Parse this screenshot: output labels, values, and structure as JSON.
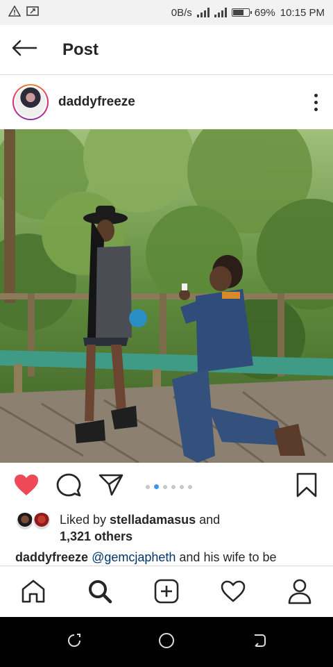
{
  "status_bar": {
    "data_speed": "0B/s",
    "battery": "69%",
    "time": "10:15 PM",
    "icons": [
      "warning-icon",
      "screen-icon",
      "signal-icon",
      "signal-4g-icon",
      "battery-icon"
    ]
  },
  "header": {
    "title": "Post",
    "back_icon": "arrow-left-icon"
  },
  "post": {
    "username": "daddyfreeze",
    "more_icon": "more-vertical-icon",
    "image_alt": "proposal photo in forest boardwalk",
    "carousel": {
      "count": 6,
      "active_index": 1
    }
  },
  "actions": {
    "like_icon": "heart-filled-icon",
    "comment_icon": "comment-icon",
    "share_icon": "send-icon",
    "save_icon": "bookmark-icon",
    "like_color": "#ed4956"
  },
  "likes": {
    "prefix": "Liked by ",
    "user": "stelladamasus",
    "middle": " and",
    "count": "1,321 others"
  },
  "caption": {
    "username": "daddyfreeze",
    "mention": "@gemcjapheth",
    "text": " and his wife to be"
  },
  "bottom_nav": [
    "home-icon",
    "search-icon",
    "add-post-icon",
    "activity-heart-icon",
    "profile-icon"
  ],
  "system_nav": [
    "recent-apps-icon",
    "home-circle-icon",
    "back-icon"
  ],
  "colors": {
    "accent": "#3897f0",
    "like": "#ed4956",
    "text": "#262626"
  }
}
